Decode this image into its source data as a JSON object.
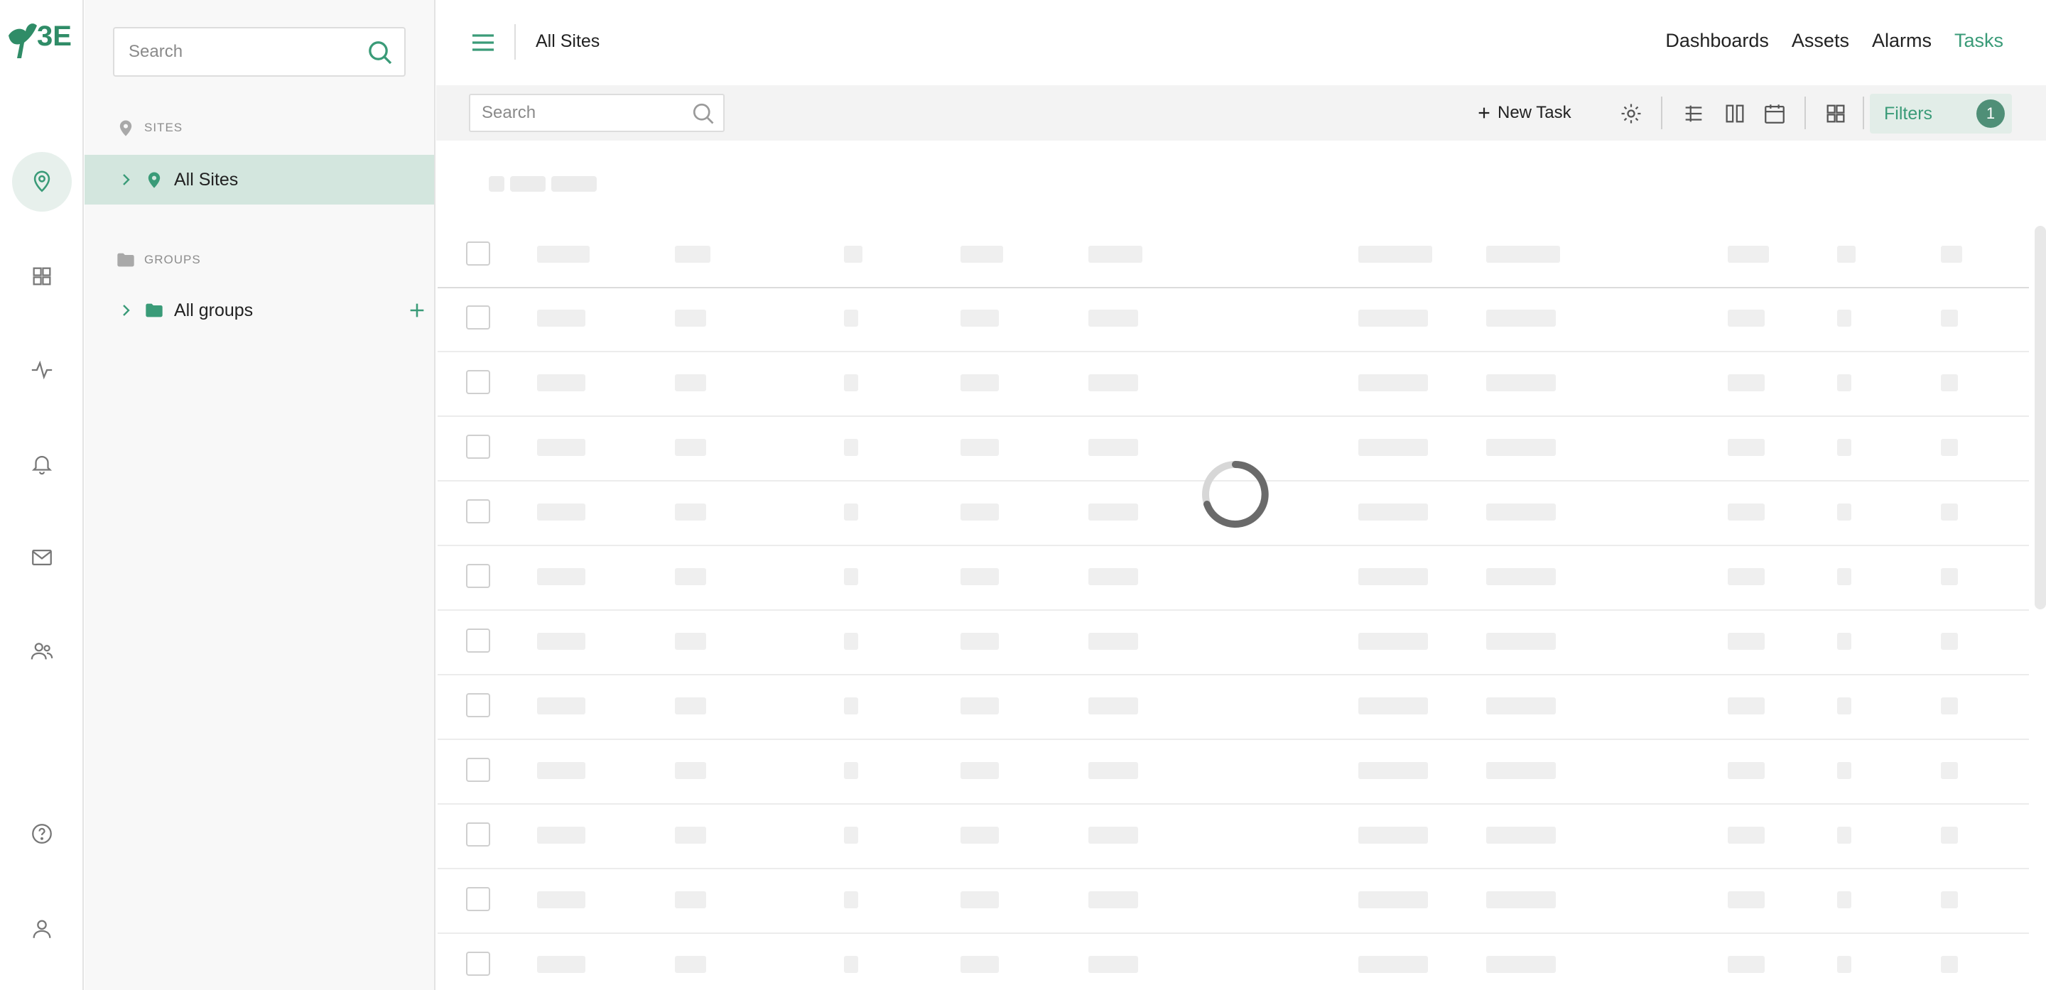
{
  "brand": {
    "logo_text": "3E",
    "accent_color": "#3a9b78",
    "selected_bg": "#d3e6de"
  },
  "rail": {
    "items": [
      {
        "icon": "map-pin-icon",
        "active": true
      },
      {
        "icon": "grid-icon"
      },
      {
        "icon": "activity-icon"
      },
      {
        "icon": "bell-icon"
      },
      {
        "icon": "mail-icon"
      },
      {
        "icon": "users-icon"
      },
      {
        "icon": "help-icon"
      },
      {
        "icon": "user-icon"
      }
    ]
  },
  "tree": {
    "search_placeholder": "Search",
    "sites_label": "SITES",
    "sites_item": "All Sites",
    "groups_label": "GROUPS",
    "groups_item": "All groups"
  },
  "topbar": {
    "breadcrumb": "All Sites",
    "nav": [
      "Dashboards",
      "Assets",
      "Alarms",
      "Tasks"
    ],
    "active_nav": "Tasks"
  },
  "toolbar": {
    "search_placeholder": "Search",
    "new_task_label": "New Task",
    "filters_label": "Filters",
    "filters_count": "1"
  },
  "table": {
    "state": "loading",
    "row_count": 11
  }
}
